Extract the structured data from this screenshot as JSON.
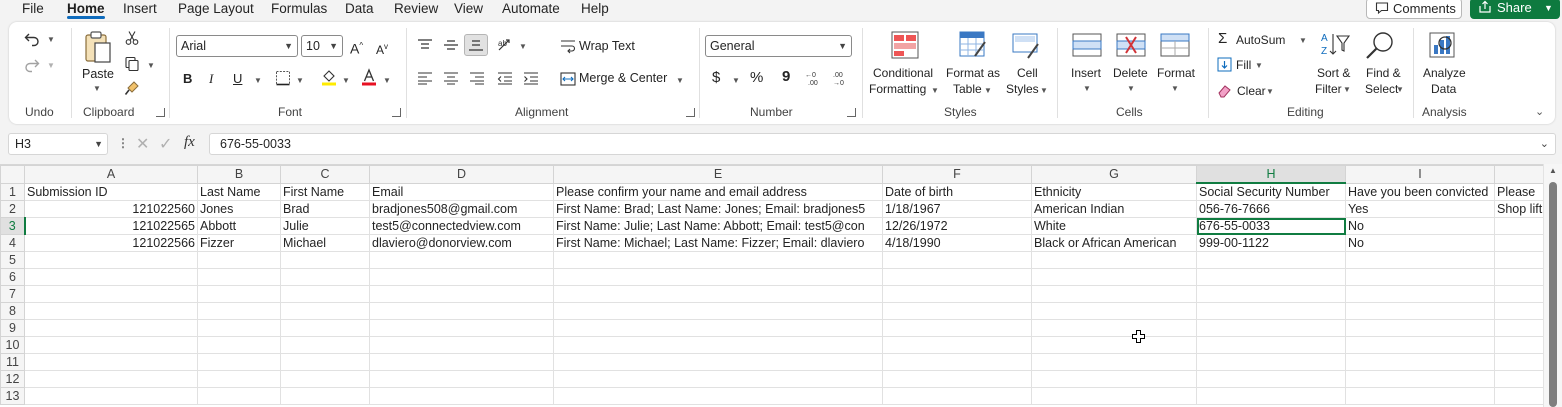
{
  "tabs": [
    "File",
    "Home",
    "Insert",
    "Page Layout",
    "Formulas",
    "Data",
    "Review",
    "View",
    "Automate",
    "Help"
  ],
  "active_tab": "Home",
  "top_buttons": {
    "comments": "Comments",
    "share": "Share"
  },
  "colors": {
    "accent": "#107c41",
    "share_bg": "#0e7a3f",
    "tab_underline": "#0f6cbd"
  },
  "ribbon": {
    "undo": {
      "group": "Undo"
    },
    "clipboard": {
      "group": "Clipboard",
      "paste": "Paste"
    },
    "font": {
      "group": "Font",
      "name": "Arial",
      "size": "10",
      "bold": "B",
      "italic": "I",
      "underline": "U"
    },
    "alignment": {
      "group": "Alignment",
      "wrap_text": "Wrap Text",
      "merge_center": "Merge & Center"
    },
    "number": {
      "group": "Number",
      "format": "General",
      "currency": "$",
      "percent": "%",
      "comma": "9"
    },
    "styles": {
      "group": "Styles",
      "conditional_1": "Conditional",
      "conditional_2": "Formatting",
      "format_table_1": "Format as",
      "format_table_2": "Table",
      "cell_styles_1": "Cell",
      "cell_styles_2": "Styles"
    },
    "cells": {
      "group": "Cells",
      "insert": "Insert",
      "delete": "Delete",
      "format": "Format"
    },
    "editing": {
      "group": "Editing",
      "autosum": "AutoSum",
      "fill": "Fill",
      "clear": "Clear",
      "sort_1": "Sort &",
      "sort_2": "Filter",
      "find_1": "Find &",
      "find_2": "Select"
    },
    "analysis": {
      "group": "Analysis",
      "analyze_1": "Analyze",
      "analyze_2": "Data"
    }
  },
  "formula_bar": {
    "name_box": "H3",
    "fx": "fx",
    "content": "676-55-0033"
  },
  "grid": {
    "columns": [
      "A",
      "B",
      "C",
      "D",
      "E",
      "F",
      "G",
      "H",
      "I",
      ""
    ],
    "selected_column": "H",
    "selected_row": 3,
    "rows": [
      {
        "n": "1",
        "cells": [
          "Submission ID",
          "Last Name",
          "First Name",
          "Email",
          "Please confirm your name and email address",
          "Date of birth",
          "Ethnicity",
          "Social Security Number",
          "Have you been convicted",
          "Please"
        ]
      },
      {
        "n": "2",
        "cells": [
          "121022560",
          "Jones",
          "Brad",
          "bradjones508@gmail.com",
          "First Name: Brad; Last Name: Jones; Email: bradjones5",
          "1/18/1967",
          "American Indian",
          "056-76-7666",
          "Yes",
          "Shop lift"
        ]
      },
      {
        "n": "3",
        "cells": [
          "121022565",
          "Abbott",
          "Julie",
          "test5@connectedview.com",
          "First Name: Julie; Last Name: Abbott; Email: test5@con",
          "12/26/1972",
          "White",
          "676-55-0033",
          "No",
          ""
        ]
      },
      {
        "n": "4",
        "cells": [
          "121022566",
          "Fizzer",
          "Michael",
          "dlaviero@donorview.com",
          "First Name: Michael; Last Name: Fizzer; Email: dlaviero",
          "4/18/1990",
          "Black or African American",
          "999-00-1122",
          "No",
          ""
        ]
      },
      {
        "n": "5",
        "cells": [
          "",
          "",
          "",
          "",
          "",
          "",
          "",
          "",
          "",
          ""
        ]
      },
      {
        "n": "6",
        "cells": [
          "",
          "",
          "",
          "",
          "",
          "",
          "",
          "",
          "",
          ""
        ]
      },
      {
        "n": "7",
        "cells": [
          "",
          "",
          "",
          "",
          "",
          "",
          "",
          "",
          "",
          ""
        ]
      },
      {
        "n": "8",
        "cells": [
          "",
          "",
          "",
          "",
          "",
          "",
          "",
          "",
          "",
          ""
        ]
      },
      {
        "n": "9",
        "cells": [
          "",
          "",
          "",
          "",
          "",
          "",
          "",
          "",
          "",
          ""
        ]
      },
      {
        "n": "10",
        "cells": [
          "",
          "",
          "",
          "",
          "",
          "",
          "",
          "",
          "",
          ""
        ]
      },
      {
        "n": "11",
        "cells": [
          "",
          "",
          "",
          "",
          "",
          "",
          "",
          "",
          "",
          ""
        ]
      },
      {
        "n": "12",
        "cells": [
          "",
          "",
          "",
          "",
          "",
          "",
          "",
          "",
          "",
          ""
        ]
      },
      {
        "n": "13",
        "cells": [
          "",
          "",
          "",
          "",
          "",
          "",
          "",
          "",
          "",
          ""
        ]
      }
    ]
  }
}
